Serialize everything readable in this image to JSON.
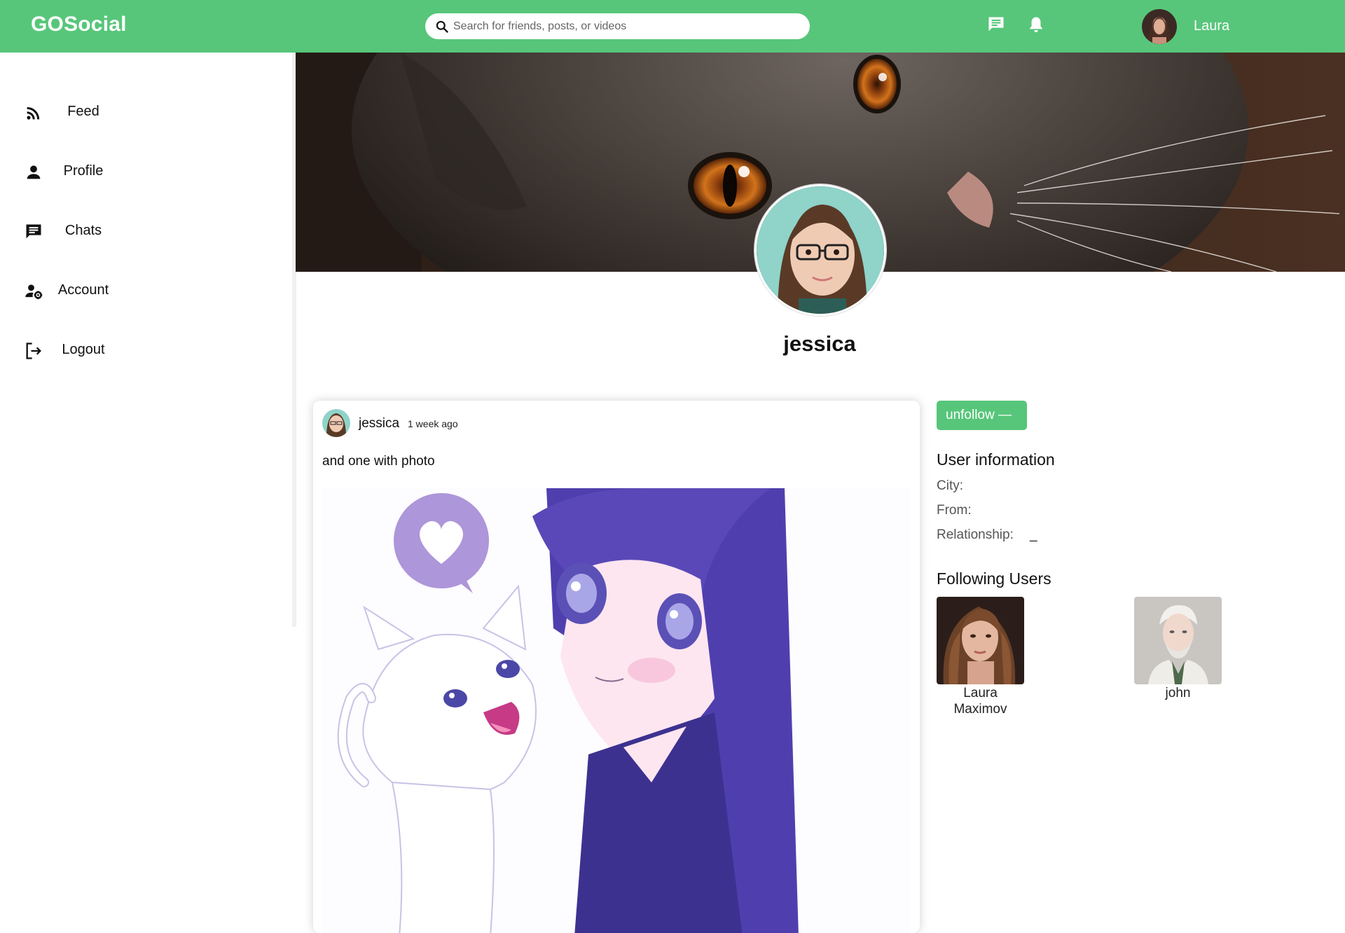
{
  "app": {
    "logo": "GOSocial",
    "search_placeholder": "Search for friends, posts, or videos",
    "current_user": "Laura",
    "brand_color": "#57c67a"
  },
  "topbar_icons": [
    "chat-icon",
    "bell-icon"
  ],
  "sidebar": {
    "items": [
      {
        "label": "Feed",
        "icon": "rss-icon"
      },
      {
        "label": "Profile",
        "icon": "person-icon"
      },
      {
        "label": "Chats",
        "icon": "chat-icon"
      },
      {
        "label": "Account",
        "icon": "user-gear-icon"
      },
      {
        "label": "Logout",
        "icon": "logout-icon"
      }
    ]
  },
  "profile": {
    "name": "jessica",
    "action_label": "unfollow —"
  },
  "post": {
    "author": "jessica",
    "time": "1 week ago",
    "text": "and one with photo"
  },
  "user_info": {
    "title": "User information",
    "city_label": "City:",
    "city_value": "",
    "from_label": "From:",
    "from_value": "",
    "relationship_label": "Relationship:",
    "relationship_value": "_"
  },
  "following": {
    "title": "Following Users",
    "users": [
      {
        "name": "Laura Maximov"
      },
      {
        "name": "john"
      }
    ]
  }
}
